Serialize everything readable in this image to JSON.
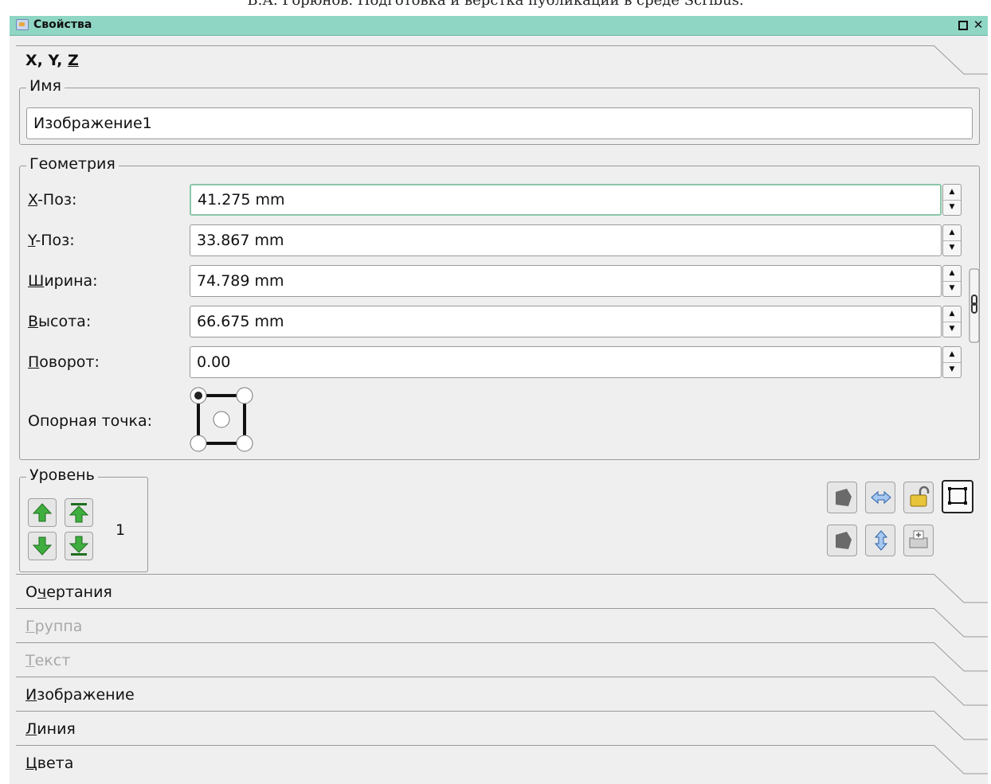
{
  "caption": "В.А. Горюнов. Подготовка и верстка публикации в среде Scribus.",
  "window": {
    "title": "Свойства",
    "float_icon": "float-icon",
    "close_icon": "close-icon",
    "close_glyph": "✕"
  },
  "xyz": {
    "label_x": "X, Y, ",
    "label_z": "Z",
    "name_group": "Имя",
    "name_value": "Изображение1",
    "geometry_group": "Геометрия",
    "fields": [
      {
        "label_u": "X",
        "label_rest": "-Поз:",
        "value": "41.275 mm"
      },
      {
        "label_u": "Y",
        "label_rest": "-Поз:",
        "value": "33.867 mm"
      },
      {
        "label_u": "Ш",
        "label_rest": "ирина:",
        "value": "74.789 mm"
      },
      {
        "label_u": "В",
        "label_rest": "ысота:",
        "value": "66.675 mm"
      },
      {
        "label_u": "П",
        "label_rest": "оворот:",
        "value": "0.00"
      }
    ],
    "anchor_label": "Опорная точка:",
    "level_group": "Уровень",
    "level_value": "1"
  },
  "sections": [
    {
      "u": "",
      "pre": "О",
      "mid": "ч",
      "rest": "ертания",
      "disabled": false
    },
    {
      "u": "Г",
      "pre": "",
      "mid": "",
      "rest": "руппа",
      "disabled": true
    },
    {
      "u": "Т",
      "pre": "",
      "mid": "",
      "rest": "екст",
      "disabled": true
    },
    {
      "u": "И",
      "pre": "",
      "mid": "",
      "rest": "зображение",
      "disabled": false
    },
    {
      "u": "Л",
      "pre": "",
      "mid": "",
      "rest": "иния",
      "disabled": false
    },
    {
      "u": "Ц",
      "pre": "",
      "mid": "",
      "rest": "вета",
      "disabled": false
    }
  ],
  "colors": {
    "titlebar": "#8fd6c4",
    "panel": "#efefef",
    "arrow_green": "#3fae3f",
    "focus": "#8cc7a8"
  }
}
